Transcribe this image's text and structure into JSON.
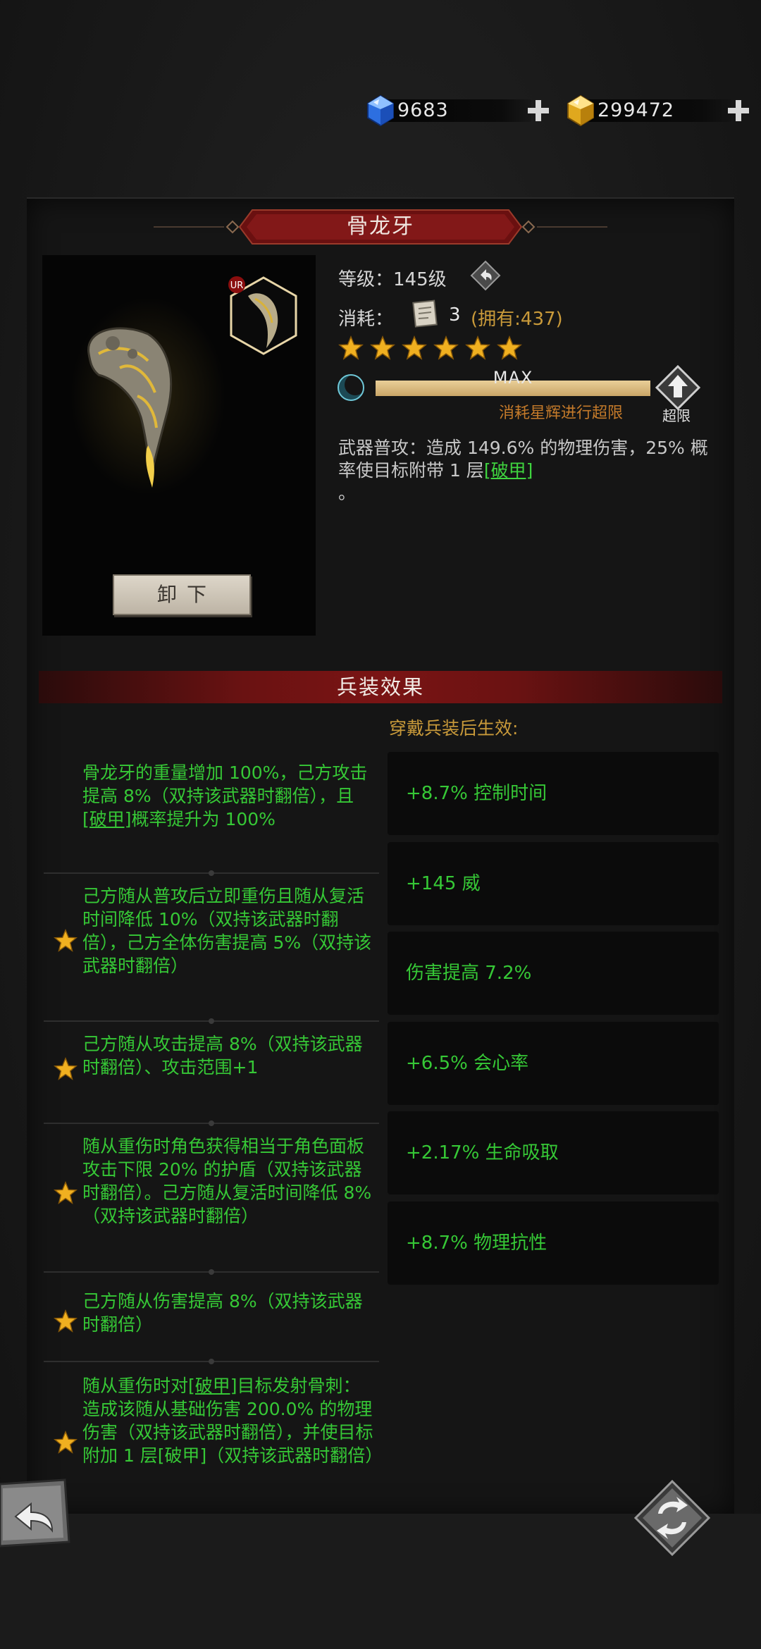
{
  "currency": {
    "gems": "9683",
    "gold": "299472"
  },
  "title": "骨龙牙",
  "badge": "UR",
  "unequip_label": "卸下",
  "stats": {
    "level_label": "等级：",
    "level_value": "145级",
    "cost_label": "消耗：",
    "cost_value": "3",
    "owned": "(拥有:437)",
    "stars": 6
  },
  "progress": {
    "text": "MAX",
    "fraction": 1.0,
    "hint": "消耗星辉进行超限",
    "limit_label": "超限"
  },
  "description": {
    "text_before": "武器普攻：造成 149.6% 的物理伤害，25% 概率使目标附带 1 层",
    "keyword": "[破甲]",
    "text_after": "。"
  },
  "effects_header": "兵装效果",
  "effects_sub": "穿戴兵装后生效:",
  "effects": [
    {
      "pre": "骨龙牙的重量增加 100%，己方攻击提高 8%（双持该武器时翻倍），且",
      "kw": "[破甲]",
      "post": "概率提升为 100%",
      "star": false
    },
    {
      "pre": "己方随从普攻后立即重伤且随从复活时间降低 10%（双持该武器时翻倍），己方全体伤害提高 5%（双持该武器时翻倍）",
      "kw": "",
      "post": "",
      "star": true
    },
    {
      "pre": "己方随从攻击提高 8%（双持该武器时翻倍）、攻击范围+1",
      "kw": "",
      "post": "",
      "star": true
    },
    {
      "pre": "随从重伤时角色获得相当于角色面板攻击下限 20% 的护盾（双持该武器时翻倍）。己方随从复活时间降低 8%（双持该武器时翻倍）",
      "kw": "",
      "post": "",
      "star": true
    },
    {
      "pre": "己方随从伤害提高 8%（双持该武器时翻倍）",
      "kw": "",
      "post": "",
      "star": true
    },
    {
      "pre": "随从重伤时对",
      "kw": "[破甲]",
      "post": "目标发射骨刺：造成该随从基础伤害 200.0% 的物理伤害（双持该武器时翻倍），并使目标附加 1 层[破甲]（双持该武器时翻倍）",
      "star": true
    }
  ],
  "bonuses": [
    "+8.7% 控制时间",
    "+145 威",
    "伤害提高 7.2%",
    "+6.5% 会心率",
    "+2.17% 生命吸取",
    "+8.7% 物理抗性"
  ],
  "colors": {
    "effect_green": "#36c836",
    "accent_gold": "#c99a3a",
    "hint_orange": "#c47a2a",
    "header_red": "#7a1414"
  }
}
